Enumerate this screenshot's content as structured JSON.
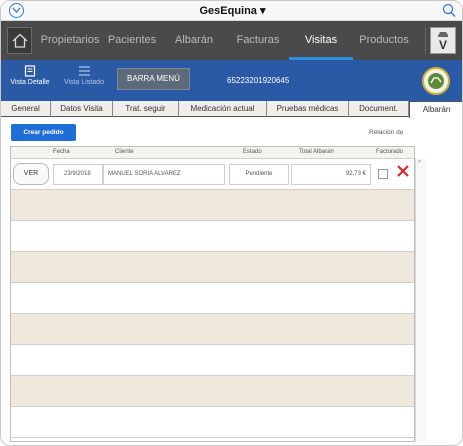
{
  "app": {
    "title": "GesEquina ▾"
  },
  "nav": {
    "items": [
      {
        "label": "Propietarios"
      },
      {
        "label": "Pacientes"
      },
      {
        "label": "Albarán"
      },
      {
        "label": "Facturas"
      },
      {
        "label": "Visitas"
      },
      {
        "label": "Productos"
      }
    ],
    "active_index": 4,
    "logo_letter": "V"
  },
  "toolbar": {
    "detalle_label": "Vista Detalle",
    "listado_label": "Vista Listado",
    "barra_label": "BARRA MENÚ",
    "code": "65223201920645"
  },
  "subtabs": [
    {
      "label": "General"
    },
    {
      "label": "Datos Visita"
    },
    {
      "label": "Trat. seguir"
    },
    {
      "label": "Medicación actual"
    },
    {
      "label": "Pruebas médicas"
    },
    {
      "label": "Document."
    },
    {
      "label": "Albarán"
    }
  ],
  "content": {
    "crear_label": "Crear pedido",
    "relacion_label": "Relación de"
  },
  "table": {
    "headers": {
      "fecha": "Fecha",
      "cliente": "Cliente",
      "estado": "Estado",
      "total": "Total Albaran",
      "facturado": "Facturado"
    },
    "rows": [
      {
        "ver": "VER",
        "fecha": "23/9/2018",
        "cliente": "MANUEL SORIA ALVAREZ",
        "estado": "Pendiente",
        "total": "92,73 €",
        "facturado": false
      }
    ]
  },
  "colors": {
    "accent": "#2a5aa5",
    "nav_bg": "#4a4a4a",
    "button_blue": "#1f6ed8",
    "row_alt": "#efe8dc",
    "delete_red": "#d62b2b"
  }
}
